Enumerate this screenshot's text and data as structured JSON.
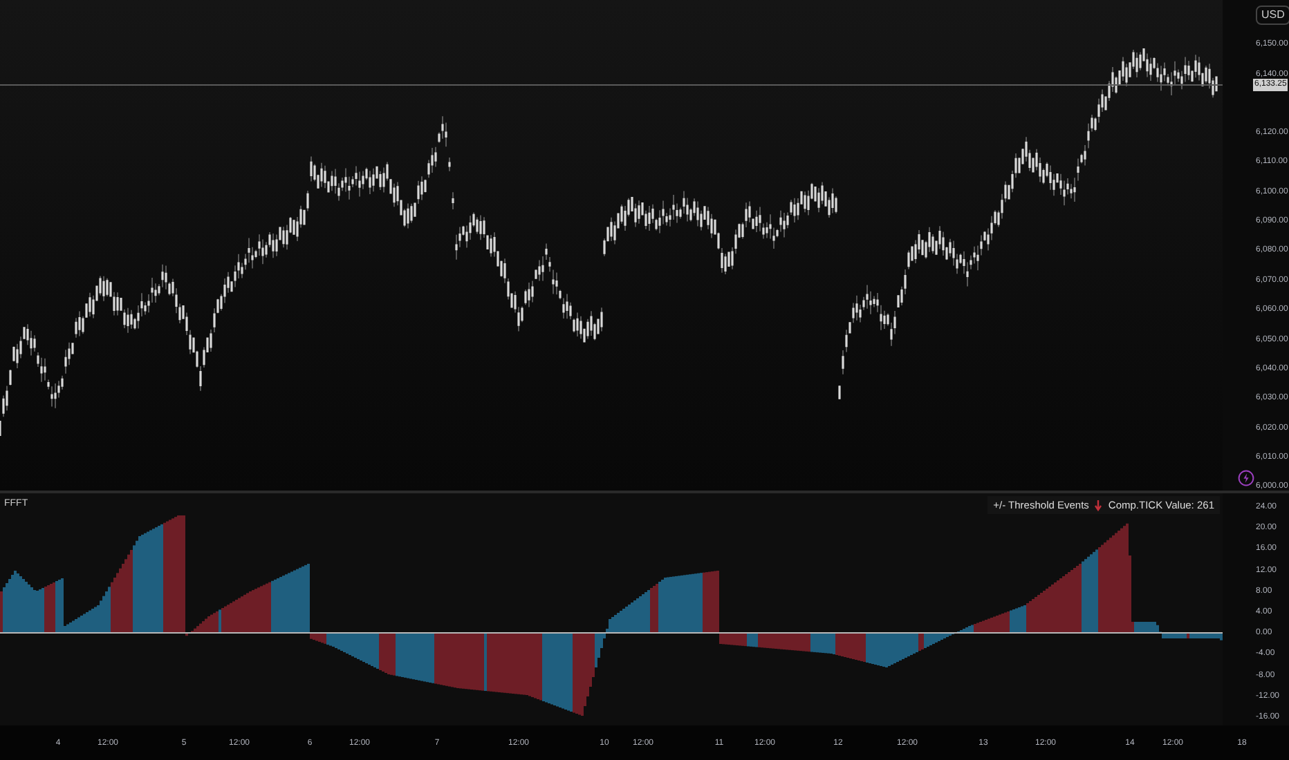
{
  "price_pane": {
    "currency": "USD",
    "last_price": "6,133.25",
    "axis_labels": [
      "6,150.00",
      "6,140.00",
      "6,120.00",
      "6,110.00",
      "6,100.00",
      "6,090.00",
      "6,080.00",
      "6,070.00",
      "6,060.00",
      "6,050.00",
      "6,040.00",
      "6,030.00",
      "6,020.00",
      "6,010.00",
      "6,000.00"
    ]
  },
  "indicator_pane": {
    "title": "FFFT",
    "legend": [
      "+/- Threshold Events",
      "Comp.TICK Value: 261"
    ],
    "axis_labels": [
      "24.00",
      "20.00",
      "16.00",
      "12.00",
      "8.00",
      "4.00",
      "0.00",
      "-4.00",
      "-8.00",
      "-12.00",
      "-16.00"
    ]
  },
  "time_axis": [
    "4",
    "12:00",
    "5",
    "12:00",
    "6",
    "12:00",
    "7",
    "12:00",
    "10",
    "12:00",
    "11",
    "12:00",
    "12",
    "12:00",
    "13",
    "12:00",
    "14",
    "12:00",
    "18"
  ]
}
